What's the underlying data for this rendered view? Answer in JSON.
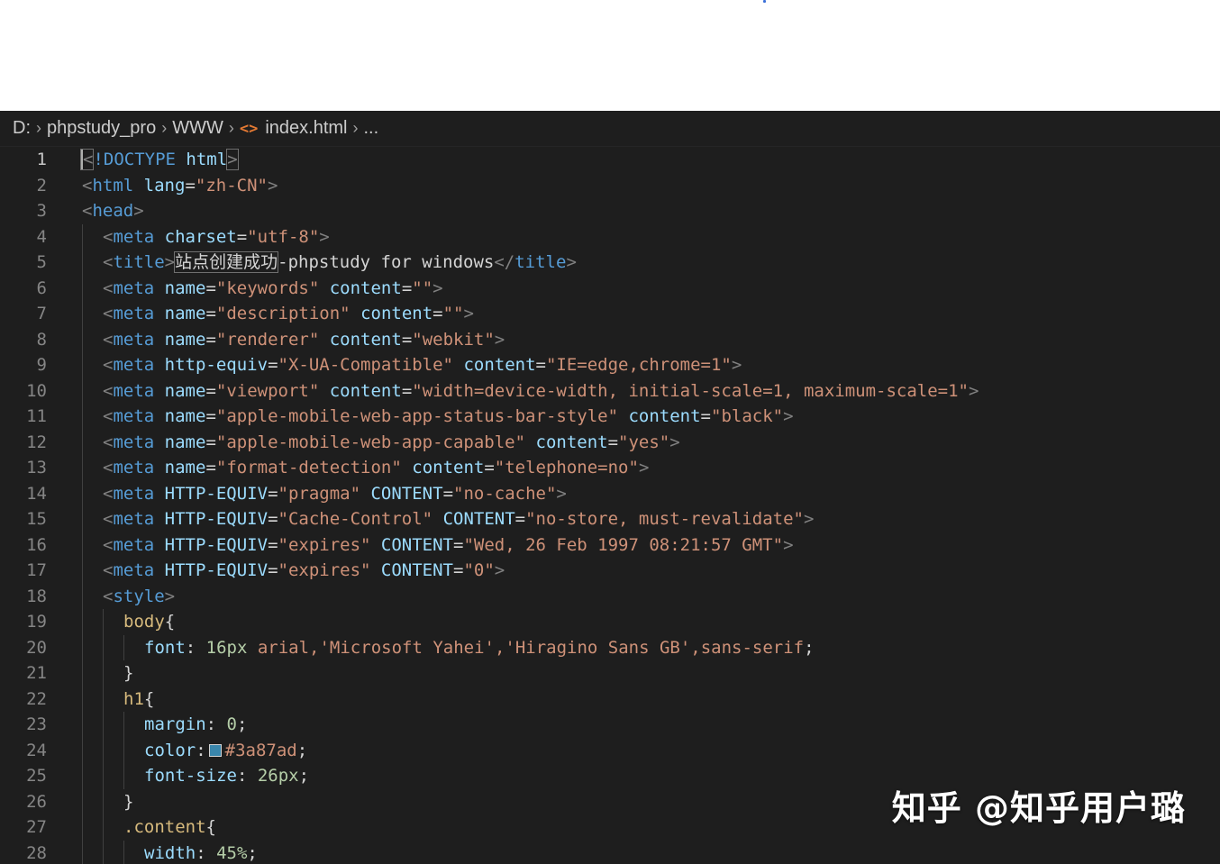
{
  "breadcrumb": [
    "D:",
    "phpstudy_pro",
    "WWW",
    "index.html",
    "..."
  ],
  "colors": {
    "editor_bg": "#1e1e1e",
    "tag": "#569cd6",
    "attribute": "#9cdcfe",
    "string": "#ce9178",
    "selector": "#d7ba7d",
    "number": "#b5cea8",
    "swatch": "#3a87ad"
  },
  "lines": [
    {
      "n": "1",
      "indent": 0,
      "t": [
        [
          "br",
          "<"
        ],
        [
          "tag",
          "!DOCTYPE"
        ],
        [
          "txt",
          " "
        ],
        [
          "attr",
          "html"
        ],
        [
          "br",
          ">"
        ]
      ]
    },
    {
      "n": "2",
      "indent": 0,
      "t": [
        [
          "br",
          "<"
        ],
        [
          "tag",
          "html"
        ],
        [
          "txt",
          " "
        ],
        [
          "attr",
          "lang"
        ],
        [
          "txt",
          "="
        ],
        [
          "str",
          "\"zh-CN\""
        ],
        [
          "br",
          ">"
        ]
      ]
    },
    {
      "n": "3",
      "indent": 0,
      "t": [
        [
          "br",
          "<"
        ],
        [
          "tag",
          "head"
        ],
        [
          "br",
          ">"
        ]
      ]
    },
    {
      "n": "4",
      "indent": 1,
      "t": [
        [
          "br",
          "<"
        ],
        [
          "tag",
          "meta"
        ],
        [
          "txt",
          " "
        ],
        [
          "attr",
          "charset"
        ],
        [
          "txt",
          "="
        ],
        [
          "str",
          "\"utf-8\""
        ],
        [
          "br",
          ">"
        ]
      ]
    },
    {
      "n": "5",
      "indent": 1,
      "t": [
        [
          "br",
          "<"
        ],
        [
          "tag",
          "title"
        ],
        [
          "br",
          ">"
        ],
        [
          "box",
          "站点创建成功"
        ],
        [
          "txt",
          "-phpstudy for windows"
        ],
        [
          "br",
          "</"
        ],
        [
          "tag",
          "title"
        ],
        [
          "br",
          ">"
        ]
      ]
    },
    {
      "n": "6",
      "indent": 1,
      "t": [
        [
          "br",
          "<"
        ],
        [
          "tag",
          "meta"
        ],
        [
          "txt",
          " "
        ],
        [
          "attr",
          "name"
        ],
        [
          "txt",
          "="
        ],
        [
          "str",
          "\"keywords\""
        ],
        [
          "txt",
          " "
        ],
        [
          "attr",
          "content"
        ],
        [
          "txt",
          "="
        ],
        [
          "str",
          "\"\""
        ],
        [
          "br",
          ">"
        ]
      ]
    },
    {
      "n": "7",
      "indent": 1,
      "t": [
        [
          "br",
          "<"
        ],
        [
          "tag",
          "meta"
        ],
        [
          "txt",
          " "
        ],
        [
          "attr",
          "name"
        ],
        [
          "txt",
          "="
        ],
        [
          "str",
          "\"description\""
        ],
        [
          "txt",
          " "
        ],
        [
          "attr",
          "content"
        ],
        [
          "txt",
          "="
        ],
        [
          "str",
          "\"\""
        ],
        [
          "br",
          ">"
        ]
      ]
    },
    {
      "n": "8",
      "indent": 1,
      "t": [
        [
          "br",
          "<"
        ],
        [
          "tag",
          "meta"
        ],
        [
          "txt",
          " "
        ],
        [
          "attr",
          "name"
        ],
        [
          "txt",
          "="
        ],
        [
          "str",
          "\"renderer\""
        ],
        [
          "txt",
          " "
        ],
        [
          "attr",
          "content"
        ],
        [
          "txt",
          "="
        ],
        [
          "str",
          "\"webkit\""
        ],
        [
          "br",
          ">"
        ]
      ]
    },
    {
      "n": "9",
      "indent": 1,
      "t": [
        [
          "br",
          "<"
        ],
        [
          "tag",
          "meta"
        ],
        [
          "txt",
          " "
        ],
        [
          "attr",
          "http-equiv"
        ],
        [
          "txt",
          "="
        ],
        [
          "str",
          "\"X-UA-Compatible\""
        ],
        [
          "txt",
          " "
        ],
        [
          "attr",
          "content"
        ],
        [
          "txt",
          "="
        ],
        [
          "str",
          "\"IE=edge,chrome=1\""
        ],
        [
          "br",
          ">"
        ]
      ]
    },
    {
      "n": "10",
      "indent": 1,
      "t": [
        [
          "br",
          "<"
        ],
        [
          "tag",
          "meta"
        ],
        [
          "txt",
          " "
        ],
        [
          "attr",
          "name"
        ],
        [
          "txt",
          "="
        ],
        [
          "str",
          "\"viewport\""
        ],
        [
          "txt",
          " "
        ],
        [
          "attr",
          "content"
        ],
        [
          "txt",
          "="
        ],
        [
          "str",
          "\"width=device-width, initial-scale=1, maximum-scale=1\""
        ],
        [
          "br",
          ">"
        ]
      ]
    },
    {
      "n": "11",
      "indent": 1,
      "t": [
        [
          "br",
          "<"
        ],
        [
          "tag",
          "meta"
        ],
        [
          "txt",
          " "
        ],
        [
          "attr",
          "name"
        ],
        [
          "txt",
          "="
        ],
        [
          "str",
          "\"apple-mobile-web-app-status-bar-style\""
        ],
        [
          "txt",
          " "
        ],
        [
          "attr",
          "content"
        ],
        [
          "txt",
          "="
        ],
        [
          "str",
          "\"black\""
        ],
        [
          "br",
          ">"
        ]
      ]
    },
    {
      "n": "12",
      "indent": 1,
      "t": [
        [
          "br",
          "<"
        ],
        [
          "tag",
          "meta"
        ],
        [
          "txt",
          " "
        ],
        [
          "attr",
          "name"
        ],
        [
          "txt",
          "="
        ],
        [
          "str",
          "\"apple-mobile-web-app-capable\""
        ],
        [
          "txt",
          " "
        ],
        [
          "attr",
          "content"
        ],
        [
          "txt",
          "="
        ],
        [
          "str",
          "\"yes\""
        ],
        [
          "br",
          ">"
        ]
      ]
    },
    {
      "n": "13",
      "indent": 1,
      "t": [
        [
          "br",
          "<"
        ],
        [
          "tag",
          "meta"
        ],
        [
          "txt",
          " "
        ],
        [
          "attr",
          "name"
        ],
        [
          "txt",
          "="
        ],
        [
          "str",
          "\"format-detection\""
        ],
        [
          "txt",
          " "
        ],
        [
          "attr",
          "content"
        ],
        [
          "txt",
          "="
        ],
        [
          "str",
          "\"telephone=no\""
        ],
        [
          "br",
          ">"
        ]
      ]
    },
    {
      "n": "14",
      "indent": 1,
      "t": [
        [
          "br",
          "<"
        ],
        [
          "tag",
          "meta"
        ],
        [
          "txt",
          " "
        ],
        [
          "attr",
          "HTTP-EQUIV"
        ],
        [
          "txt",
          "="
        ],
        [
          "str",
          "\"pragma\""
        ],
        [
          "txt",
          " "
        ],
        [
          "attr",
          "CONTENT"
        ],
        [
          "txt",
          "="
        ],
        [
          "str",
          "\"no-cache\""
        ],
        [
          "br",
          ">"
        ]
      ]
    },
    {
      "n": "15",
      "indent": 1,
      "t": [
        [
          "br",
          "<"
        ],
        [
          "tag",
          "meta"
        ],
        [
          "txt",
          " "
        ],
        [
          "attr",
          "HTTP-EQUIV"
        ],
        [
          "txt",
          "="
        ],
        [
          "str",
          "\"Cache-Control\""
        ],
        [
          "txt",
          " "
        ],
        [
          "attr",
          "CONTENT"
        ],
        [
          "txt",
          "="
        ],
        [
          "str",
          "\"no-store, must-revalidate\""
        ],
        [
          "br",
          ">"
        ]
      ]
    },
    {
      "n": "16",
      "indent": 1,
      "t": [
        [
          "br",
          "<"
        ],
        [
          "tag",
          "meta"
        ],
        [
          "txt",
          " "
        ],
        [
          "attr",
          "HTTP-EQUIV"
        ],
        [
          "txt",
          "="
        ],
        [
          "str",
          "\"expires\""
        ],
        [
          "txt",
          " "
        ],
        [
          "attr",
          "CONTENT"
        ],
        [
          "txt",
          "="
        ],
        [
          "str",
          "\"Wed, 26 Feb 1997 08:21:57 GMT\""
        ],
        [
          "br",
          ">"
        ]
      ]
    },
    {
      "n": "17",
      "indent": 1,
      "t": [
        [
          "br",
          "<"
        ],
        [
          "tag",
          "meta"
        ],
        [
          "txt",
          " "
        ],
        [
          "attr",
          "HTTP-EQUIV"
        ],
        [
          "txt",
          "="
        ],
        [
          "str",
          "\"expires\""
        ],
        [
          "txt",
          " "
        ],
        [
          "attr",
          "CONTENT"
        ],
        [
          "txt",
          "="
        ],
        [
          "str",
          "\"0\""
        ],
        [
          "br",
          ">"
        ]
      ]
    },
    {
      "n": "18",
      "indent": 1,
      "t": [
        [
          "br",
          "<"
        ],
        [
          "tag",
          "style"
        ],
        [
          "br",
          ">"
        ]
      ]
    },
    {
      "n": "19",
      "indent": 2,
      "t": [
        [
          "sel",
          "body"
        ],
        [
          "punc",
          "{"
        ]
      ]
    },
    {
      "n": "20",
      "indent": 3,
      "t": [
        [
          "prop",
          "font"
        ],
        [
          "punc",
          ": "
        ],
        [
          "num",
          "16px"
        ],
        [
          "val",
          " arial,'Microsoft Yahei','Hiragino Sans GB',sans-serif"
        ],
        [
          "punc",
          ";"
        ]
      ]
    },
    {
      "n": "21",
      "indent": 2,
      "t": [
        [
          "punc",
          "}"
        ]
      ]
    },
    {
      "n": "22",
      "indent": 2,
      "t": [
        [
          "sel",
          "h1"
        ],
        [
          "punc",
          "{"
        ]
      ]
    },
    {
      "n": "23",
      "indent": 3,
      "t": [
        [
          "prop",
          "margin"
        ],
        [
          "punc",
          ": "
        ],
        [
          "num",
          "0"
        ],
        [
          "punc",
          ";"
        ]
      ]
    },
    {
      "n": "24",
      "indent": 3,
      "t": [
        [
          "prop",
          "color"
        ],
        [
          "punc",
          ":"
        ],
        [
          "swatch",
          ""
        ],
        [
          "val",
          "#3a87ad"
        ],
        [
          "punc",
          ";"
        ]
      ]
    },
    {
      "n": "25",
      "indent": 3,
      "t": [
        [
          "prop",
          "font-size"
        ],
        [
          "punc",
          ": "
        ],
        [
          "num",
          "26px"
        ],
        [
          "punc",
          ";"
        ]
      ]
    },
    {
      "n": "26",
      "indent": 2,
      "t": [
        [
          "punc",
          "}"
        ]
      ]
    },
    {
      "n": "27",
      "indent": 2,
      "t": [
        [
          "sel",
          ".content"
        ],
        [
          "punc",
          "{"
        ]
      ]
    },
    {
      "n": "28",
      "indent": 3,
      "t": [
        [
          "prop",
          "width"
        ],
        [
          "punc",
          ": "
        ],
        [
          "num",
          "45%"
        ],
        [
          "punc",
          ";"
        ]
      ]
    }
  ],
  "watermark": "知乎 @知乎用户璐"
}
